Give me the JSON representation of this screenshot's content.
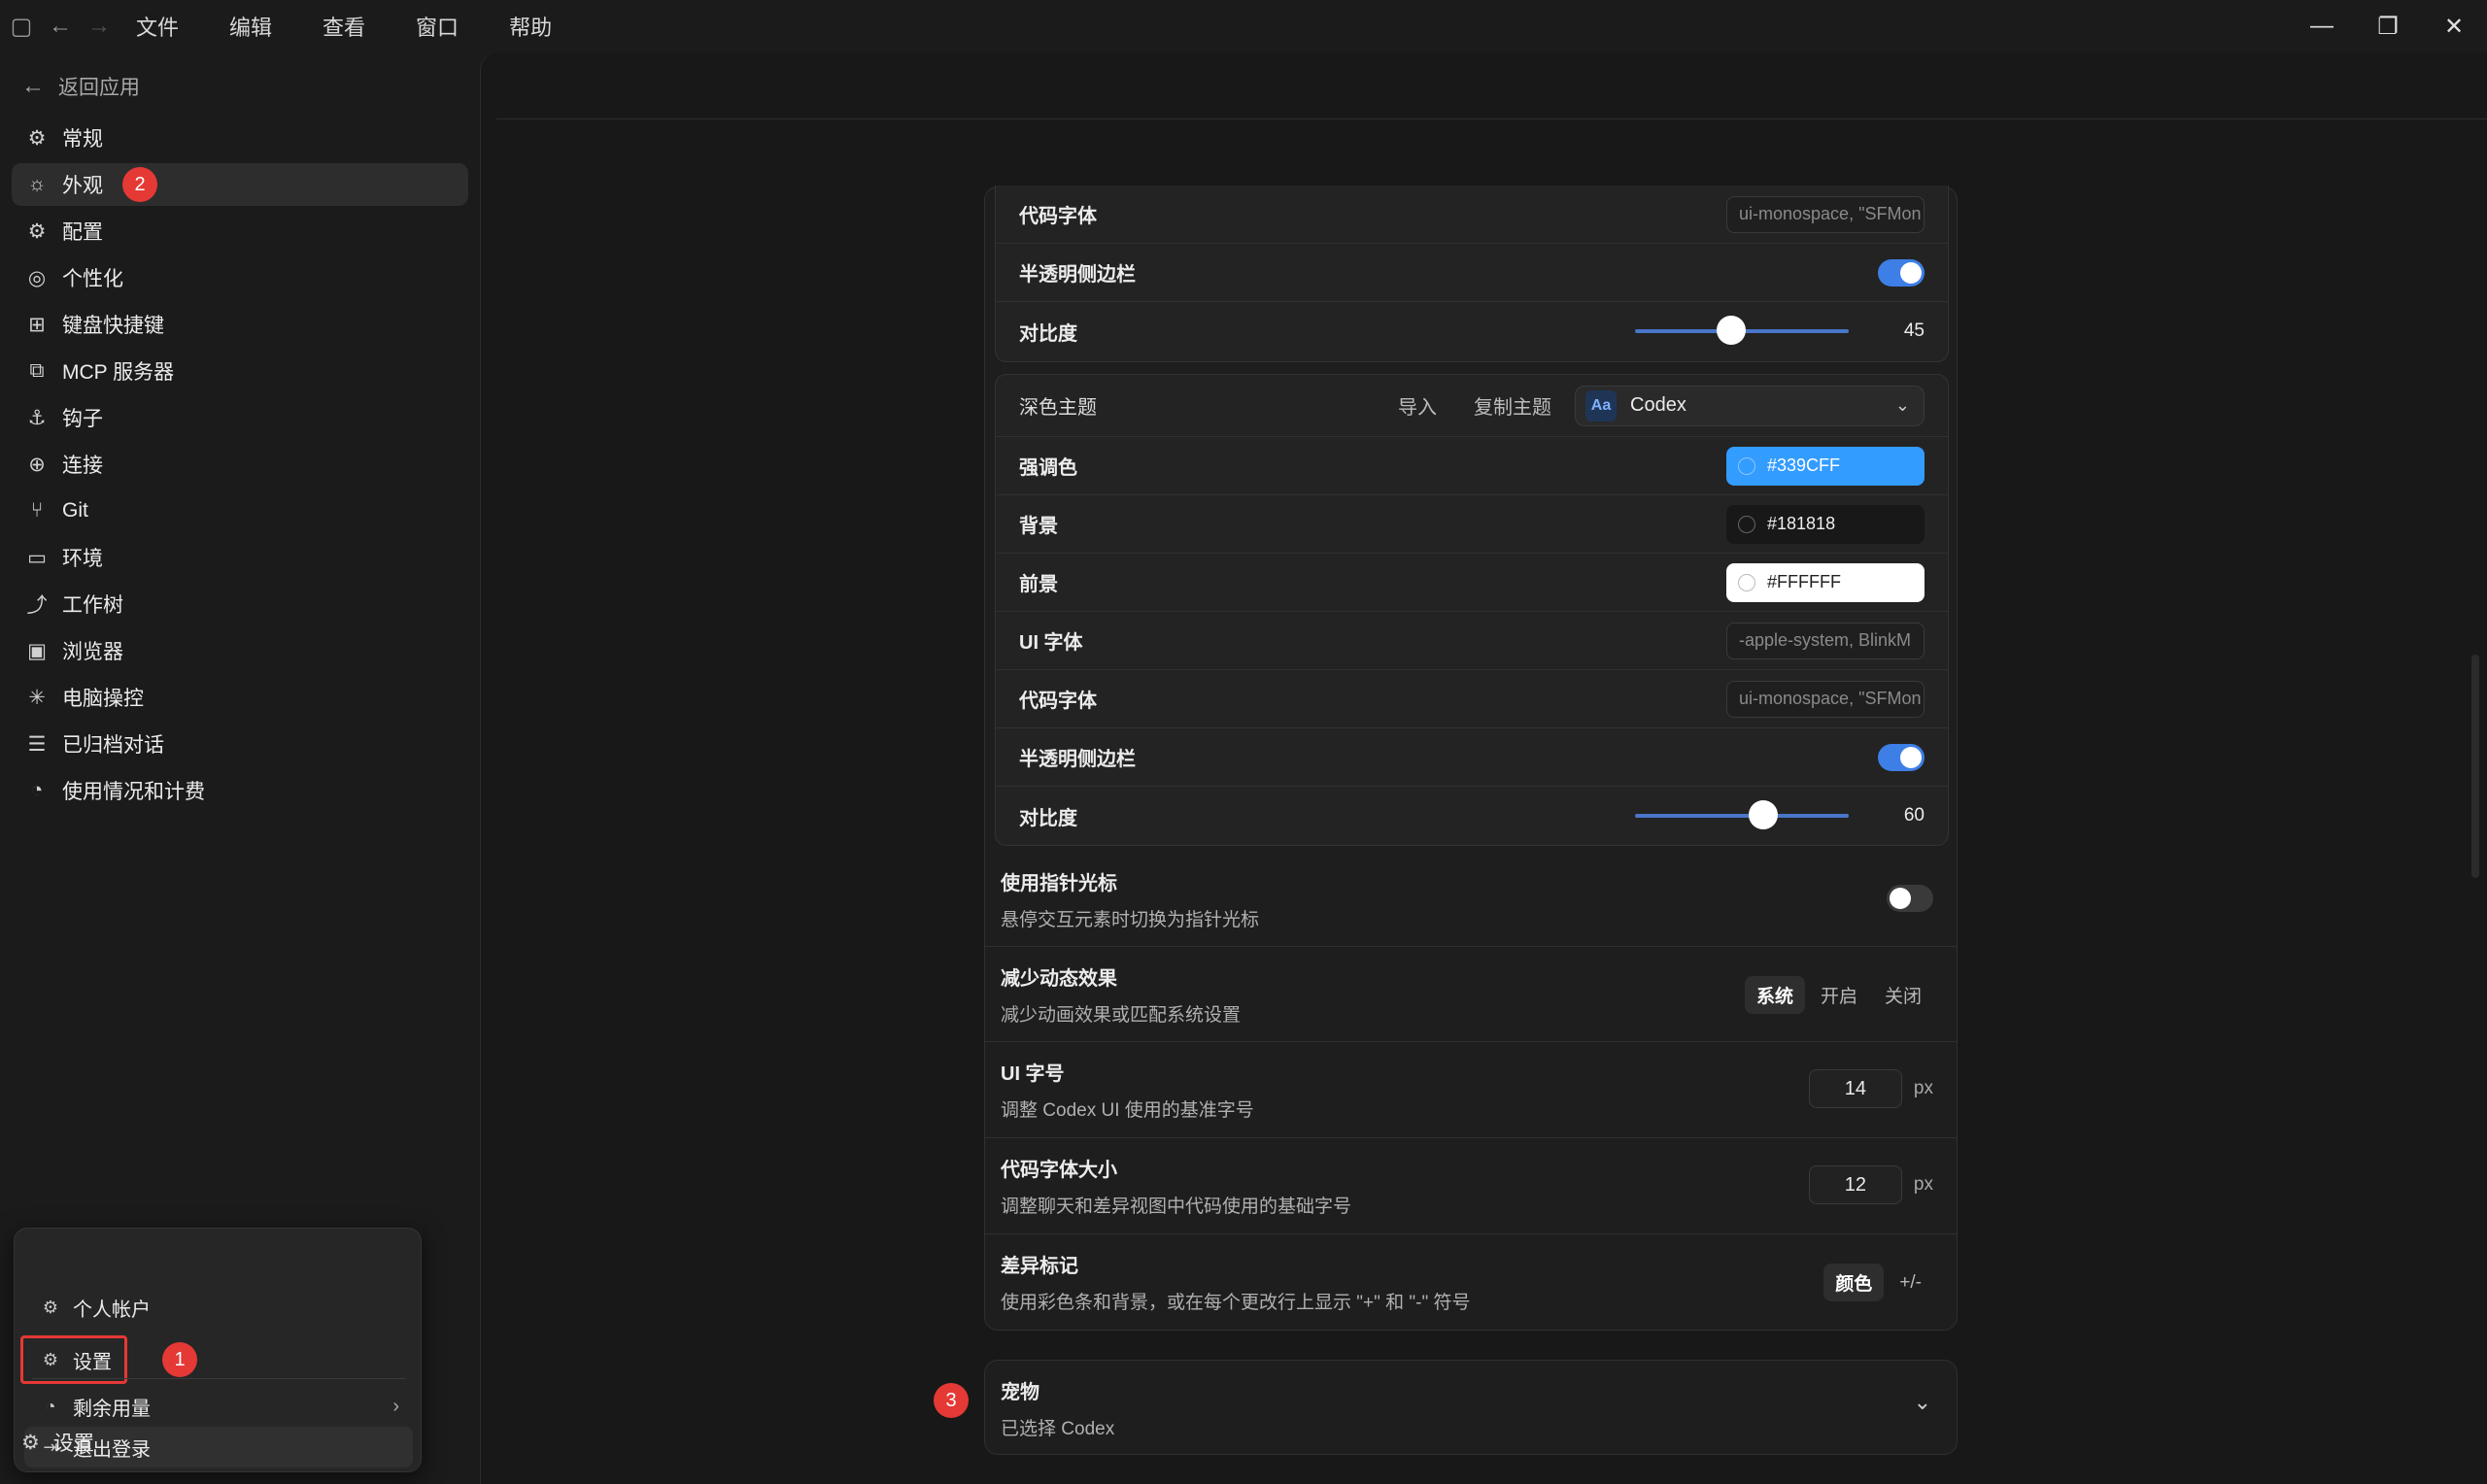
{
  "menu": [
    "文件",
    "编辑",
    "查看",
    "窗口",
    "帮助"
  ],
  "sidebar": {
    "back": "返回应用",
    "items": [
      {
        "label": "常规"
      },
      {
        "label": "外观"
      },
      {
        "label": "配置"
      },
      {
        "label": "个性化"
      },
      {
        "label": "键盘快捷键"
      },
      {
        "label": "MCP 服务器"
      },
      {
        "label": "钩子"
      },
      {
        "label": "连接"
      },
      {
        "label": "Git"
      },
      {
        "label": "环境"
      },
      {
        "label": "工作树"
      },
      {
        "label": "浏览器"
      },
      {
        "label": "电脑操控"
      },
      {
        "label": "已归档对话"
      },
      {
        "label": "使用情况和计费"
      }
    ],
    "bottom_settings": "设置"
  },
  "popup": {
    "account": "个人帐户",
    "settings": "设置",
    "usage": "剩余用量",
    "logout": "退出登录"
  },
  "annotations": {
    "one": "1",
    "two": "2",
    "three": "3"
  },
  "light_theme_tail": {
    "code_font_label": "代码字体",
    "code_font_value": "ui-monospace, \"SFMon",
    "translucent_label": "半透明侧边栏",
    "contrast_label": "对比度",
    "contrast_value": "45",
    "contrast_level": 45
  },
  "dark_theme": {
    "title": "深色主题",
    "import": "导入",
    "copy": "复制主题",
    "select_badge": "Aa",
    "select_value": "Codex",
    "accent_label": "强调色",
    "accent_value": "#339CFF",
    "background_label": "背景",
    "background_value": "#181818",
    "foreground_label": "前景",
    "foreground_value": "#FFFFFF",
    "ui_font_label": "UI 字体",
    "ui_font_value": "-apple-system, BlinkM",
    "code_font_label": "代码字体",
    "code_font_value": "ui-monospace, \"SFMon",
    "translucent_label": "半透明侧边栏",
    "contrast_label": "对比度",
    "contrast_value": "60",
    "contrast_level": 60
  },
  "pointer": {
    "title": "使用指针光标",
    "desc": "悬停交互元素时切换为指针光标"
  },
  "motion": {
    "title": "减少动态效果",
    "desc": "减少动画效果或匹配系统设置",
    "options": [
      "系统",
      "开启",
      "关闭"
    ]
  },
  "ui_size": {
    "title": "UI 字号",
    "desc": "调整 Codex UI 使用的基准字号",
    "value": "14",
    "unit": "px"
  },
  "code_size": {
    "title": "代码字体大小",
    "desc": "调整聊天和差异视图中代码使用的基础字号",
    "value": "12",
    "unit": "px"
  },
  "diff": {
    "title": "差异标记",
    "desc": "使用彩色条和背景，或在每个更改行上显示 \"+\" 和 \"-\" 符号",
    "options": [
      "颜色",
      "+/-"
    ]
  },
  "pet": {
    "title": "宠物",
    "desc": "已选择 Codex"
  }
}
